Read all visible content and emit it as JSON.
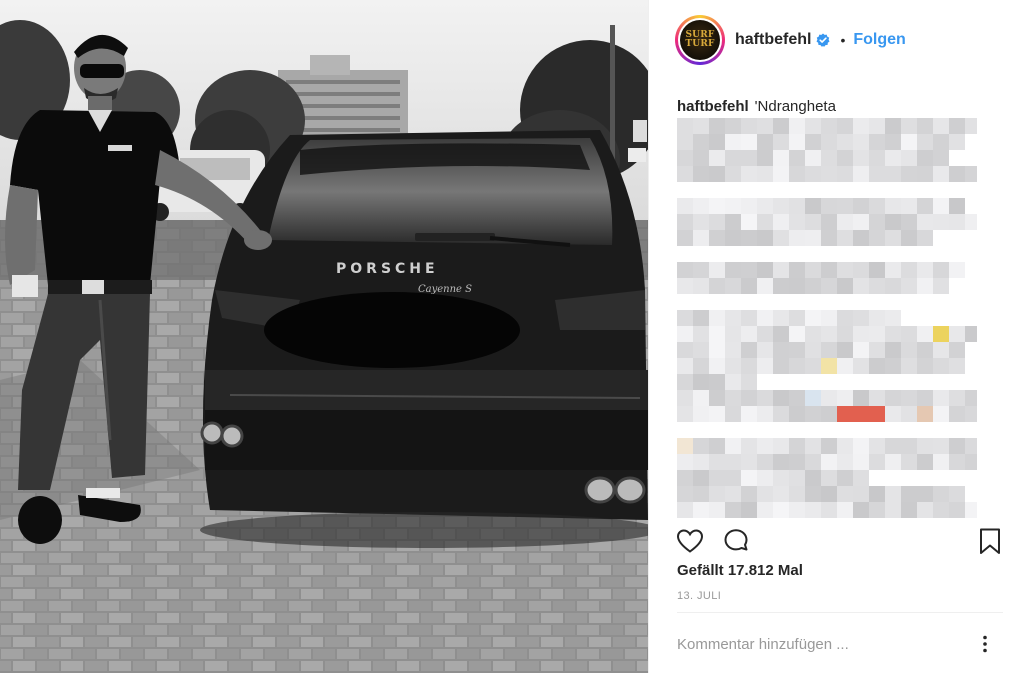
{
  "post": {
    "username": "haftbefehl",
    "avatar_logo": [
      "SURF",
      "TURF"
    ],
    "dot": "•",
    "follow_label": "Folgen",
    "caption_user": "haftbefehl",
    "caption_text": "'Ndrangheta",
    "likes_text": "Gefällt 17.812 Mal",
    "date_text": "13. JULI",
    "comment_placeholder": "Kommentar hinzufügen ...",
    "photo_brand": "PORSCHE",
    "photo_model": "Cayenne S"
  },
  "icons": {
    "verified": "verified-badge-icon",
    "like": "heart-outline-icon",
    "comment": "comment-bubble-icon",
    "save": "bookmark-icon",
    "more": "ellipsis-icon"
  },
  "colors": {
    "link_blue": "#3897f0",
    "text": "#262626",
    "muted": "#999999",
    "verified": "#3897f0",
    "blur_yellow": "#e8cf6a",
    "blur_red": "#e2604f"
  }
}
